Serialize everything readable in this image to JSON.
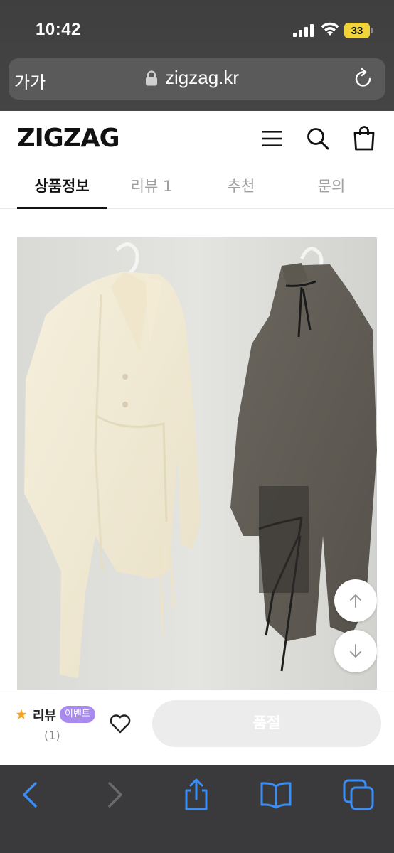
{
  "status_bar": {
    "time": "10:42",
    "battery": "33"
  },
  "url_bar": {
    "text_size_label": "가가",
    "url": "zigzag.kr"
  },
  "header": {
    "logo": "ZIGZAG"
  },
  "tabs": [
    {
      "label": "상품정보",
      "active": true
    },
    {
      "label": "리뷰 1",
      "active": false
    },
    {
      "label": "추천",
      "active": false
    },
    {
      "label": "문의",
      "active": false
    }
  ],
  "purchase_bar": {
    "review_label": "리뷰",
    "event_badge": "이벤트",
    "review_count": "(1)",
    "soldout_label": "품절"
  },
  "colors": {
    "accent_star": "#f5a623",
    "event_badge": "#a98bf0",
    "soldout_button": "#ececec"
  },
  "icons": [
    "lock-icon",
    "reload-icon",
    "menu-icon",
    "search-icon",
    "bag-icon",
    "arrow-up-icon",
    "arrow-down-icon",
    "star-icon",
    "heart-icon",
    "back-icon",
    "forward-icon",
    "share-icon",
    "bookmarks-icon",
    "tabs-icon"
  ]
}
